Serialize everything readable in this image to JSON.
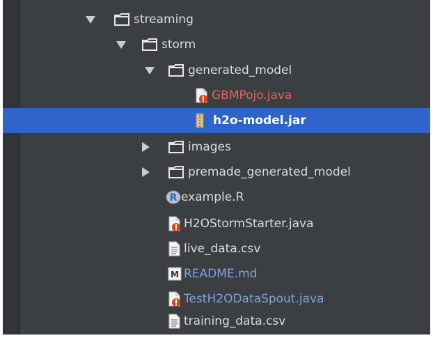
{
  "project_tree": {
    "nodes": [
      {
        "name": "streaming",
        "kind": "folder",
        "state": "expanded"
      },
      {
        "name": "storm",
        "kind": "folder",
        "state": "expanded"
      },
      {
        "name": "generated_model",
        "kind": "folder",
        "state": "expanded"
      },
      {
        "name": "GBMPojo.java",
        "kind": "java-error",
        "status": "error"
      },
      {
        "name": "h2o-model.jar",
        "kind": "jar",
        "selected": true
      },
      {
        "name": "images",
        "kind": "folder",
        "state": "collapsed"
      },
      {
        "name": "premade_generated_model",
        "kind": "folder",
        "state": "collapsed"
      },
      {
        "name": "example.R",
        "kind": "r-script"
      },
      {
        "name": "H2OStormStarter.java",
        "kind": "java-error"
      },
      {
        "name": "live_data.csv",
        "kind": "text-file"
      },
      {
        "name": "README.md",
        "kind": "markdown",
        "status": "modified"
      },
      {
        "name": "TestH2ODataSpout.java",
        "kind": "java-error",
        "status": "modified"
      },
      {
        "name": "training_data.csv",
        "kind": "text-file"
      }
    ]
  },
  "colors": {
    "background": "#3c3f41",
    "selection": "#2f65ca",
    "text": "#dadcdf",
    "error_text": "#e0675b",
    "modified_text": "#7ea3d6",
    "folder": "#e6e6e6",
    "error_badge": "#d6451c"
  }
}
